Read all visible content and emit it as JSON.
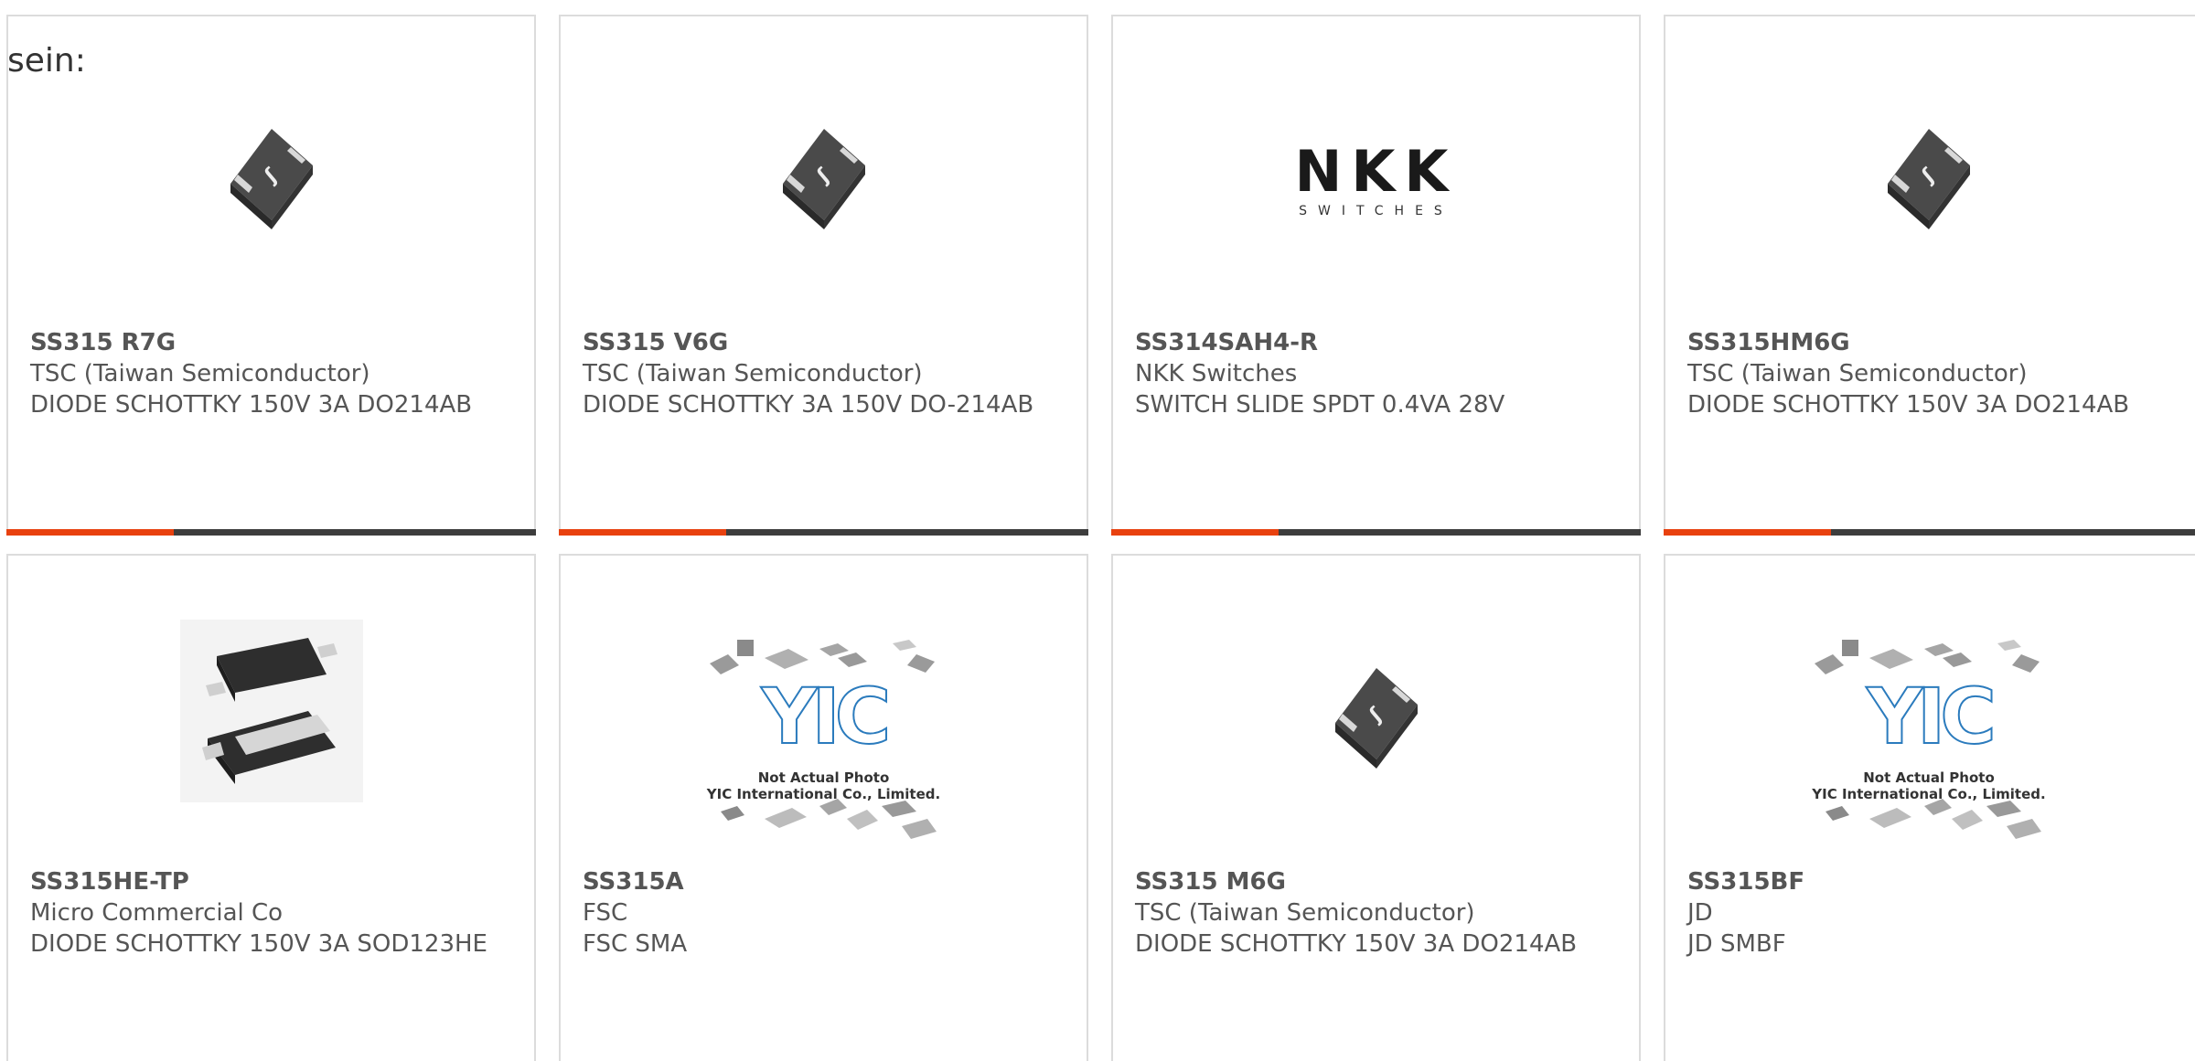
{
  "intro_text": "sein:",
  "colors": {
    "accent_orange": "#e8410f",
    "accent_dark": "#3d3d3d",
    "card_border": "#dcdcdc",
    "text": "#555555"
  },
  "products": [
    {
      "part_number": "SS315 R7G",
      "manufacturer": "TSC (Taiwan Semiconductor)",
      "description": "DIODE SCHOTTKY 150V 3A DO214AB",
      "image": "diode-package-icon"
    },
    {
      "part_number": "SS315 V6G",
      "manufacturer": "TSC (Taiwan Semiconductor)",
      "description": "DIODE SCHOTTKY 3A 150V DO-214AB",
      "image": "diode-package-icon"
    },
    {
      "part_number": "SS314SAH4-R",
      "manufacturer": "NKK Switches",
      "description": "SWITCH SLIDE SPDT 0.4VA 28V",
      "image": "nkk-switches-logo",
      "logo_text": "NKK",
      "logo_subtext": "SWITCHES"
    },
    {
      "part_number": "SS315HM6G",
      "manufacturer": "TSC (Taiwan Semiconductor)",
      "description": "DIODE SCHOTTKY 150V 3A DO214AB",
      "image": "diode-package-icon"
    },
    {
      "part_number": "SS315HE-TP",
      "manufacturer": "Micro Commercial Co",
      "description": "DIODE SCHOTTKY 150V 3A SOD123HE",
      "image": "sod123he-package-icon"
    },
    {
      "part_number": "SS315A",
      "manufacturer": "FSC",
      "description": "FSC SMA",
      "image": "yic-placeholder-image",
      "placeholder_line1": "Not Actual Photo",
      "placeholder_line2": "YIC International Co., Limited."
    },
    {
      "part_number": "SS315 M6G",
      "manufacturer": "TSC (Taiwan Semiconductor)",
      "description": "DIODE SCHOTTKY 150V 3A DO214AB",
      "image": "diode-package-icon"
    },
    {
      "part_number": "SS315BF",
      "manufacturer": "JD",
      "description": "JD SMBF",
      "image": "yic-placeholder-image",
      "placeholder_line1": "Not Actual Photo",
      "placeholder_line2": "YIC International Co., Limited."
    }
  ]
}
